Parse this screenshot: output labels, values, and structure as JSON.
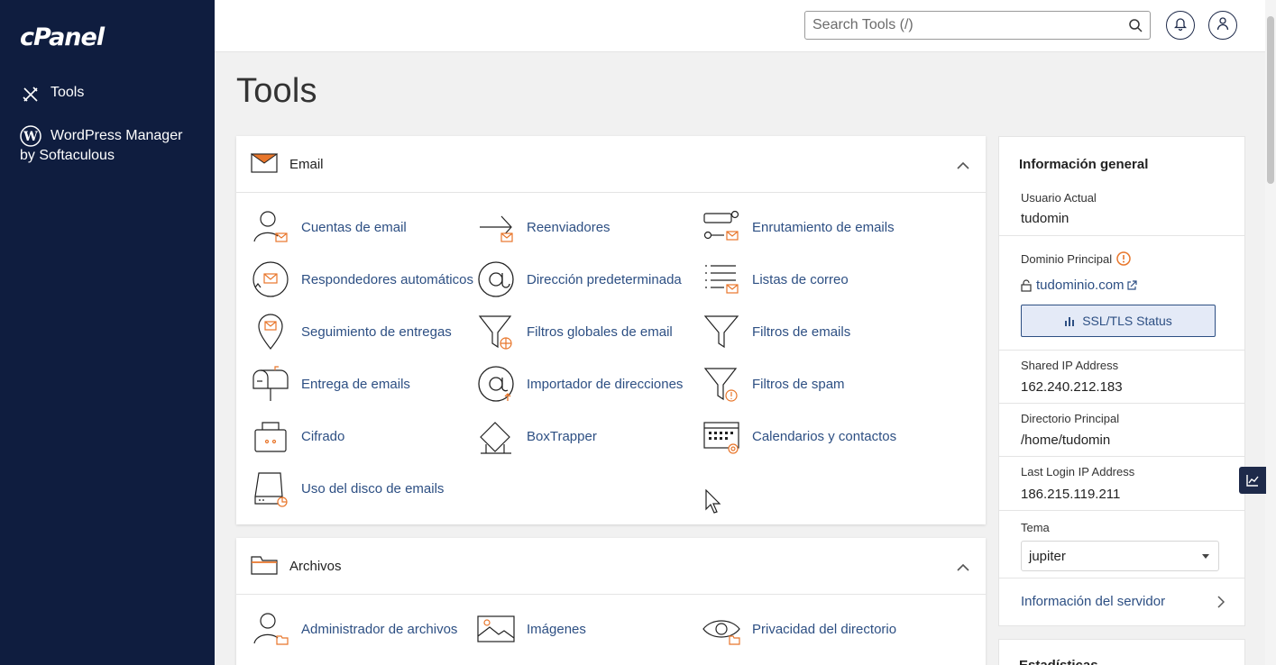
{
  "sidebar": {
    "logo": "cPanel",
    "items": [
      {
        "label": "Tools",
        "icon": "tools-icon"
      },
      {
        "label": "WordPress Manager",
        "sublabel": "by Softaculous",
        "icon": "wordpress-icon"
      }
    ]
  },
  "header": {
    "search_placeholder": "Search Tools (/)"
  },
  "page": {
    "title": "Tools"
  },
  "email_panel": {
    "title": "Email",
    "tools": [
      "Cuentas de email",
      "Reenviadores",
      "Enrutamiento de emails",
      "Respondedores automáticos",
      "Dirección predeterminada",
      "Listas de correo",
      "Seguimiento de entregas",
      "Filtros globales de email",
      "Filtros de emails",
      "Entrega de emails",
      "Importador de direcciones",
      "Filtros de spam",
      "Cifrado",
      "BoxTrapper",
      "Calendarios y contactos",
      "Uso del disco de emails"
    ]
  },
  "files_panel": {
    "title": "Archivos",
    "tools": [
      "Administrador de archivos",
      "Imágenes",
      "Privacidad del directorio"
    ]
  },
  "info": {
    "title": "Información general",
    "usuario_label": "Usuario Actual",
    "usuario_value": "tudomin",
    "dominio_label": "Dominio Principal",
    "dominio_value": "tudominio.com",
    "ssl_button": "SSL/TLS Status",
    "shared_ip_label": "Shared IP Address",
    "shared_ip_value": "162.240.212.183",
    "dir_label": "Directorio Principal",
    "dir_value": "/home/tudomin",
    "last_ip_label": "Last Login IP Address",
    "last_ip_value": "186.215.119.211",
    "tema_label": "Tema",
    "tema_value": "jupiter",
    "server_link": "Información del servidor"
  },
  "stats": {
    "title": "Estadísticas"
  },
  "colors": {
    "sidebar_bg": "#0f1d3f",
    "accent_orange": "#e8762b",
    "link_blue": "#2d4f83"
  }
}
